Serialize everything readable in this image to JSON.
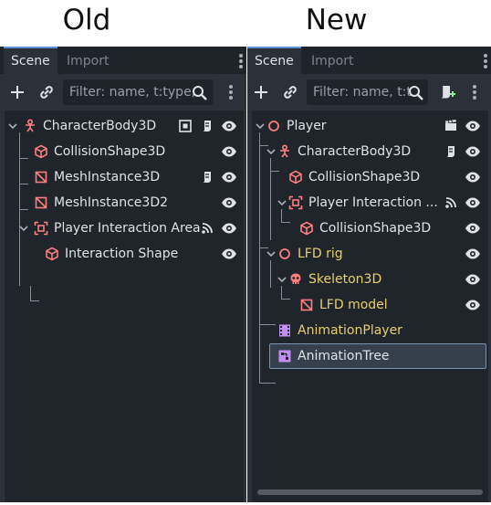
{
  "headings": {
    "old": "Old",
    "new": "New"
  },
  "panels": {
    "old": {
      "tabs": {
        "scene": "Scene",
        "import": "Import"
      },
      "filter_placeholder": "Filter: name, t:type,",
      "nodes": [
        {
          "label": "CharacterBody3D",
          "icon": "character-body-icon",
          "color": "#e0e0e0"
        },
        {
          "label": "CollisionShape3D",
          "icon": "collision-shape-icon"
        },
        {
          "label": "MeshInstance3D",
          "icon": "mesh-instance-icon"
        },
        {
          "label": "MeshInstance3D2",
          "icon": "mesh-instance-icon"
        },
        {
          "label": "Player Interaction Area",
          "icon": "area-icon"
        },
        {
          "label": "Interaction Shape",
          "icon": "collision-shape-icon"
        }
      ]
    },
    "new": {
      "tabs": {
        "scene": "Scene",
        "import": "Import"
      },
      "filter_placeholder": "Filter: name, t:t",
      "nodes": [
        {
          "label": "Player",
          "icon": "node3d-icon"
        },
        {
          "label": "CharacterBody3D",
          "icon": "character-body-icon"
        },
        {
          "label": "CollisionShape3D",
          "icon": "collision-shape-icon"
        },
        {
          "label": "Player Interaction ...",
          "icon": "area-icon"
        },
        {
          "label": "CollisionShape3D",
          "icon": "collision-shape-icon"
        },
        {
          "label": "LFD rig",
          "icon": "node3d-icon"
        },
        {
          "label": "Skeleton3D",
          "icon": "skeleton-icon"
        },
        {
          "label": "LFD model",
          "icon": "mesh-instance-icon"
        },
        {
          "label": "AnimationPlayer",
          "icon": "animation-player-icon"
        },
        {
          "label": "AnimationTree",
          "icon": "animation-tree-icon"
        }
      ]
    }
  },
  "colors": {
    "panel_bg": "#2b3039",
    "tree_bg": "#20242b",
    "node_red": "#fc7f7f",
    "node_purple": "#c38ef1",
    "inherited_yellow": "#e8cf6e",
    "text": "#dfe2e7"
  }
}
